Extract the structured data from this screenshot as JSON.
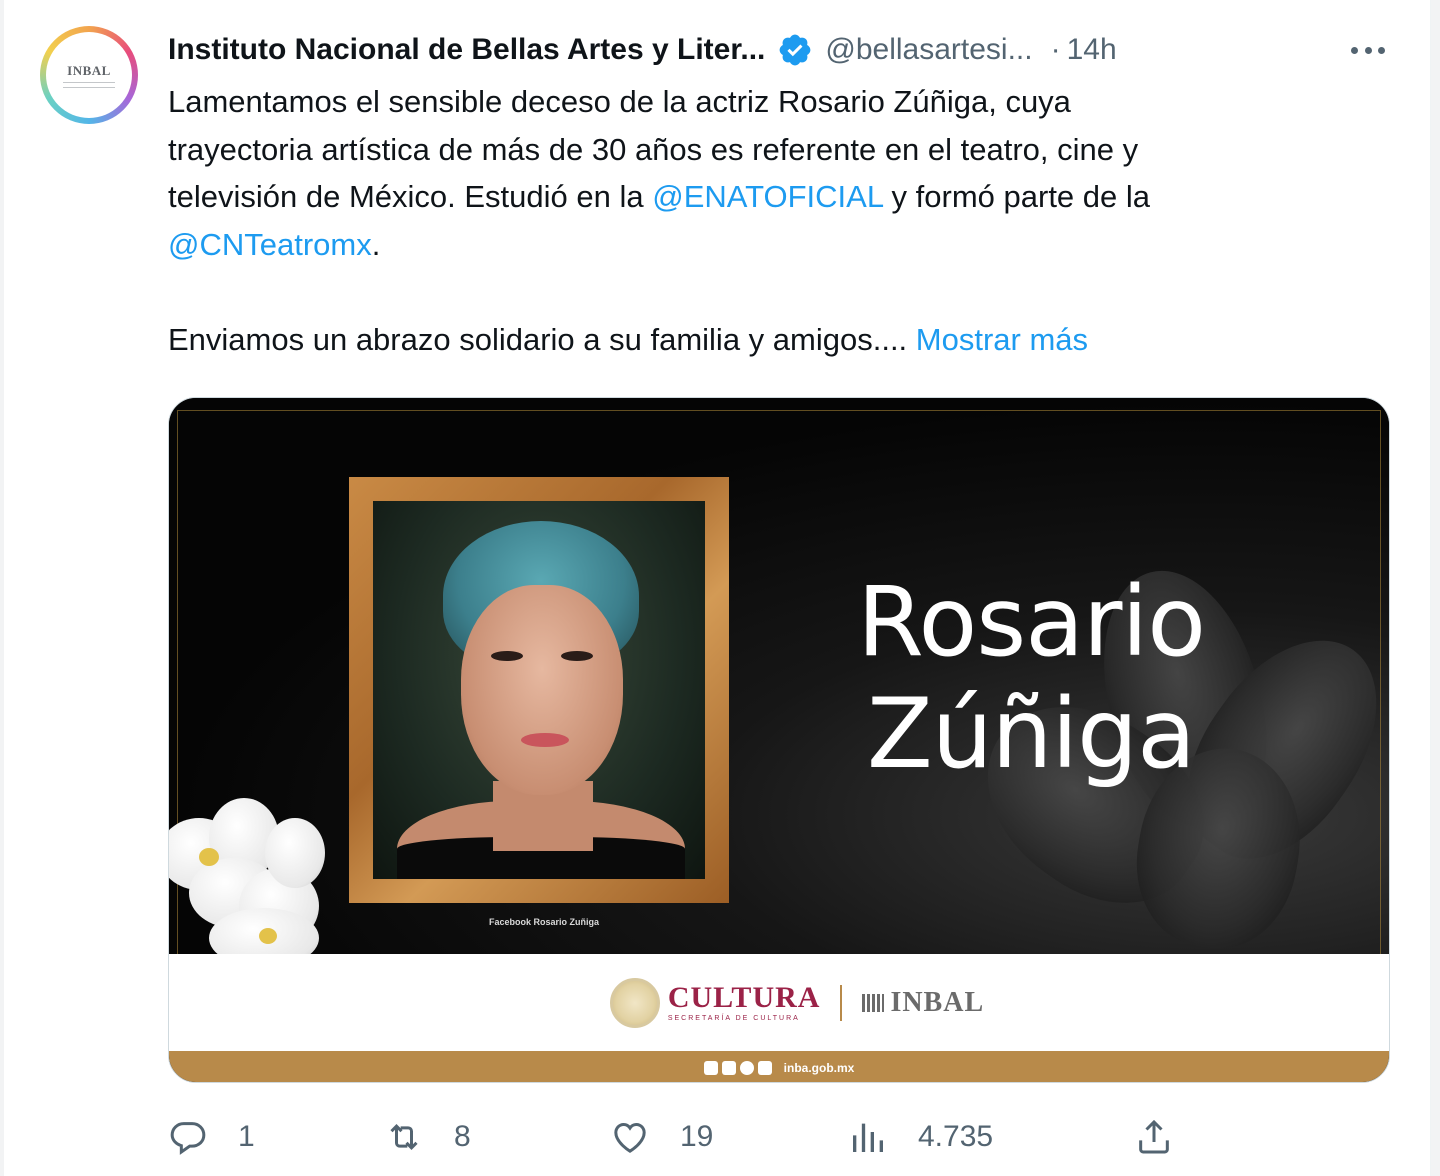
{
  "tweet": {
    "author": {
      "name": "Instituto Nacional de Bellas Artes y Liter...",
      "handle": "@bellasartesi...",
      "verified": true,
      "avatar_text": "INBAL"
    },
    "separator": "·",
    "time": "14h",
    "text": {
      "line1": "Lamentamos el sensible deceso de la  actriz Rosario Zúñiga, cuya",
      "line2": "trayectoria artística de más de 30 años es referente en el teatro, cine y",
      "line3_before": "televisión de México. Estudió en la ",
      "line3_mention": "@ENATOFICIAL",
      "line3_after": " y formó parte de la",
      "line4_mention": "@CNTeatromx",
      "line4_after": ".",
      "line5": "Enviamos un abrazo solidario a su familia y amigos.... ",
      "show_more": "Mostrar más"
    },
    "media": {
      "headline_line1": "Rosario",
      "headline_line2": "Zúñiga",
      "photo_credit": "Facebook Rosario Zuñiga",
      "footer_left": "CULTURA",
      "footer_left_sub": "SECRETARÍA DE CULTURA",
      "footer_right": "INBAL",
      "strip_url": "inba.gob.mx"
    },
    "actions": {
      "reply_count": "1",
      "retweet_count": "8",
      "like_count": "19",
      "views_count": "4.735"
    }
  },
  "colors": {
    "link": "#1d9bf0",
    "secondary_text": "#536471",
    "verified": "#1d9bf0",
    "cultura": "#9b2247",
    "gold": "#b88a4a"
  },
  "icons": {
    "verified": "verified-badge-icon",
    "more": "more-icon",
    "reply": "reply-icon",
    "retweet": "retweet-icon",
    "like": "heart-icon",
    "views": "views-icon",
    "share": "share-icon"
  }
}
